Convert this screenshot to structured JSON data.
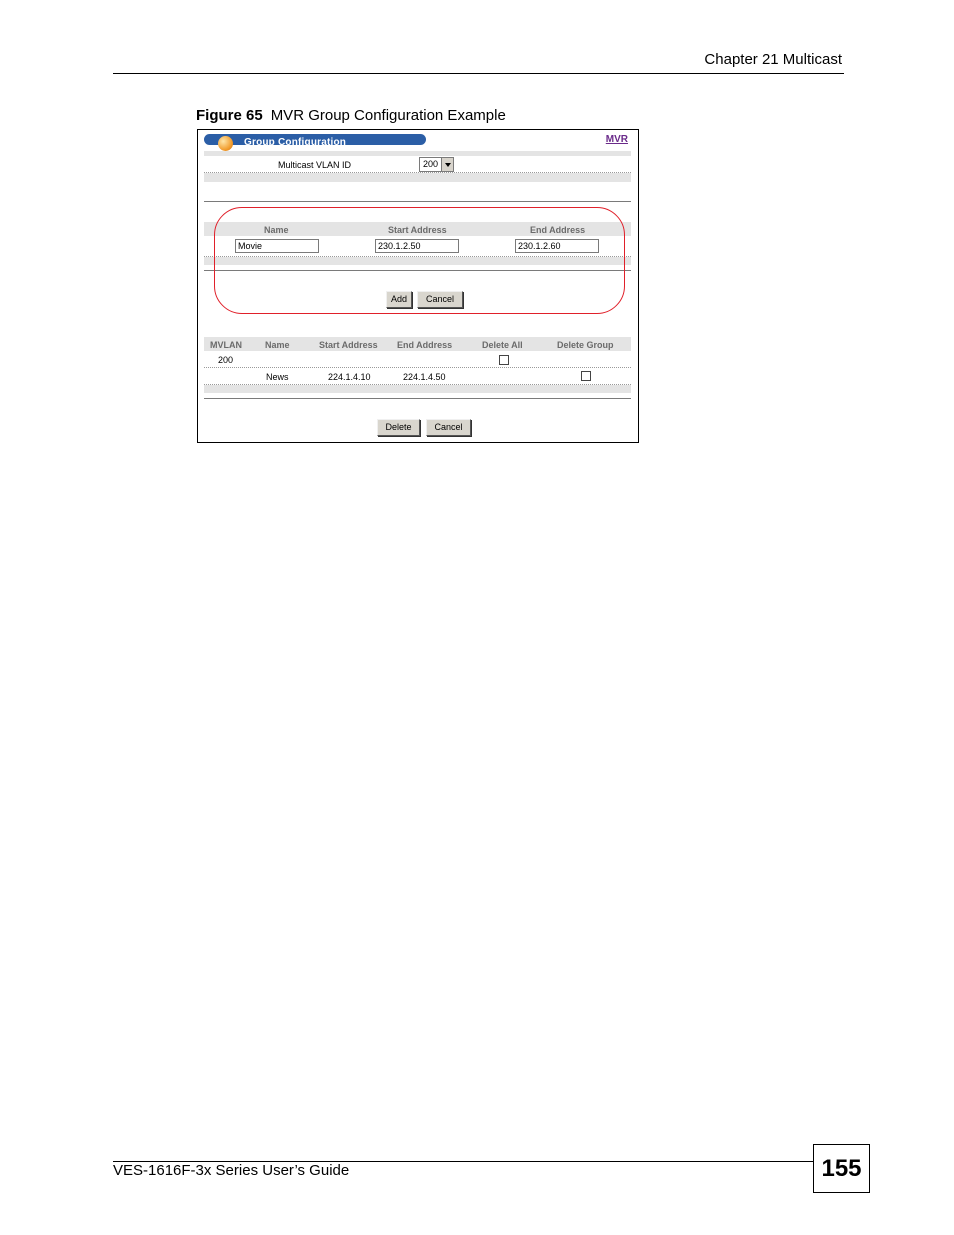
{
  "page": {
    "chapter": "Chapter 21 Multicast",
    "figure_label": "Figure 65",
    "figure_title": "MVR Group Configuration Example",
    "guide_title": "VES-1616F-3x Series User’s Guide",
    "page_number": "155"
  },
  "screen": {
    "title": "Group Configuration",
    "mvr_link": "MVR",
    "vlan_label": "Multicast VLAN ID",
    "vlan_value": "200",
    "add_form": {
      "headers": [
        "Name",
        "Start Address",
        "End Address"
      ],
      "name_value": "Movie",
      "start_value": "230.1.2.50",
      "end_value": "230.1.2.60",
      "add_label": "Add",
      "cancel_label": "Cancel"
    },
    "group_table": {
      "headers": [
        "MVLAN",
        "Name",
        "Start Address",
        "End Address",
        "Delete All",
        "Delete Group"
      ],
      "vlan_row": {
        "mvlan": "200"
      },
      "group_row": {
        "name": "News",
        "start": "224.1.4.10",
        "end": "224.1.4.50"
      },
      "delete_label": "Delete",
      "cancel_label": "Cancel"
    }
  }
}
